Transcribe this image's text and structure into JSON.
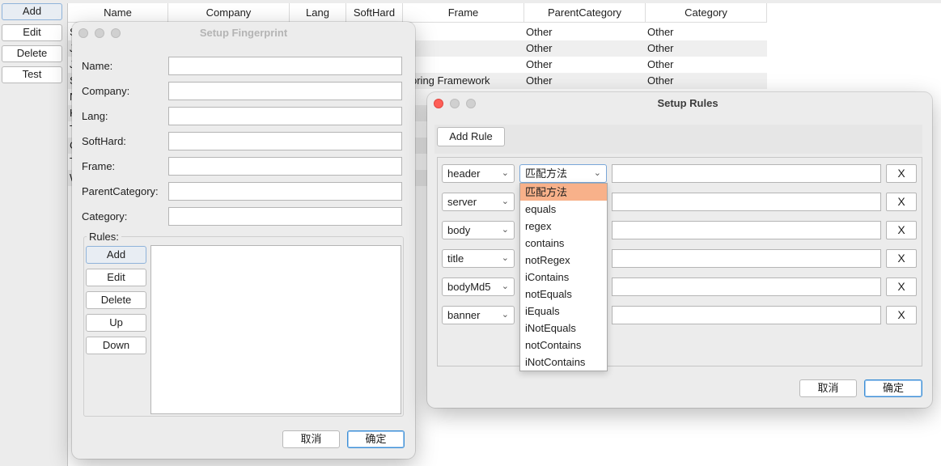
{
  "main": {
    "buttons": {
      "add": "Add",
      "edit": "Edit",
      "delete": "Delete",
      "test": "Test"
    },
    "columns": [
      "Name",
      "Company",
      "Lang",
      "SoftHard",
      "Frame",
      "ParentCategory",
      "Category"
    ],
    "rows": [
      {
        "name": "S",
        "frame": "",
        "parent": "Other",
        "category": "Other"
      },
      {
        "name": "J",
        "frame": "",
        "parent": "Other",
        "category": "Other"
      },
      {
        "name": "J",
        "frame": "",
        "parent": "Other",
        "category": "Other"
      },
      {
        "name": "S",
        "frame": "pring Framework",
        "parent": "Other",
        "category": "Other"
      },
      {
        "name": "N",
        "frame": "",
        "parent": "",
        "category": ""
      },
      {
        "name": "K",
        "frame": "",
        "parent": "",
        "category": ""
      },
      {
        "name": "T",
        "frame": "",
        "parent": "",
        "category": ""
      },
      {
        "name": "C",
        "frame": "",
        "parent": "",
        "category": ""
      },
      {
        "name": "T",
        "frame": "",
        "parent": "",
        "category": ""
      },
      {
        "name": "W",
        "frame": "",
        "parent": "",
        "category": ""
      }
    ]
  },
  "fingerprint_dialog": {
    "title": "Setup Fingerprint",
    "fields": [
      {
        "label": "Name:",
        "value": ""
      },
      {
        "label": "Company:",
        "value": ""
      },
      {
        "label": "Lang:",
        "value": ""
      },
      {
        "label": "SoftHard:",
        "value": ""
      },
      {
        "label": "Frame:",
        "value": ""
      },
      {
        "label": "ParentCategory:",
        "value": ""
      },
      {
        "label": "Category:",
        "value": ""
      }
    ],
    "rules_group_label": "Rules:",
    "rule_buttons": {
      "add": "Add",
      "edit": "Edit",
      "delete": "Delete",
      "up": "Up",
      "down": "Down"
    },
    "cancel": "取消",
    "ok": "确定"
  },
  "rules_dialog": {
    "title": "Setup Rules",
    "add_rule": "Add Rule",
    "rules": [
      {
        "field": "header",
        "method": "匹配方法",
        "value": "",
        "remove": "X"
      },
      {
        "field": "server",
        "method": "",
        "value": "",
        "remove": "X"
      },
      {
        "field": "body",
        "method": "",
        "value": "",
        "remove": "X"
      },
      {
        "field": "title",
        "method": "",
        "value": "",
        "remove": "X"
      },
      {
        "field": "bodyMd5",
        "method": "",
        "value": "",
        "remove": "X"
      },
      {
        "field": "banner",
        "method": "",
        "value": "",
        "remove": "X"
      }
    ],
    "method_options": [
      "匹配方法",
      "equals",
      "regex",
      "contains",
      "notRegex",
      "iContains",
      "notEquals",
      "iEquals",
      "iNotEquals",
      "notContains",
      "iNotContains"
    ],
    "selected_option": "匹配方法",
    "cancel": "取消",
    "ok": "确定"
  },
  "colors": {
    "highlight_option": "#f8b18a",
    "close_light": "#fe5f57",
    "focus_border": "#3d8fd6"
  }
}
